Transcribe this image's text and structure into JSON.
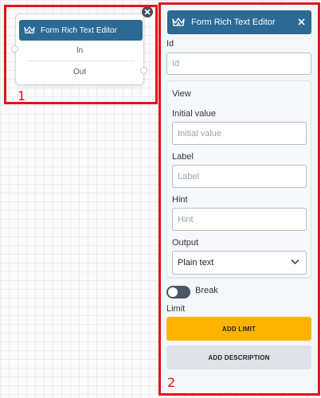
{
  "node": {
    "title": "Form Rich Text Editor",
    "port_in": "In",
    "port_out": "Out"
  },
  "panel": {
    "title": "Form Rich Text Editor",
    "id_label": "Id",
    "id_placeholder": "Id",
    "view_label": "View",
    "initial_value_label": "Initial value",
    "initial_value_placeholder": "Initial value",
    "label_label": "Label",
    "label_placeholder": "Label",
    "hint_label": "Hint",
    "hint_placeholder": "Hint",
    "output_label": "Output",
    "output_value": "Plain text",
    "break_label": "Break",
    "break_on": false,
    "limit_label": "Limit",
    "add_limit_label": "ADD LIMIT",
    "add_description_label": "ADD DESCRIPTION"
  },
  "annotations": {
    "box1": "1",
    "box2": "2"
  },
  "colors": {
    "header": "#2b6a94",
    "accent_button": "#ffb300",
    "highlight": "#e5141a"
  },
  "icons": [
    "crown-icon",
    "close-icon",
    "chevron-down-icon"
  ]
}
